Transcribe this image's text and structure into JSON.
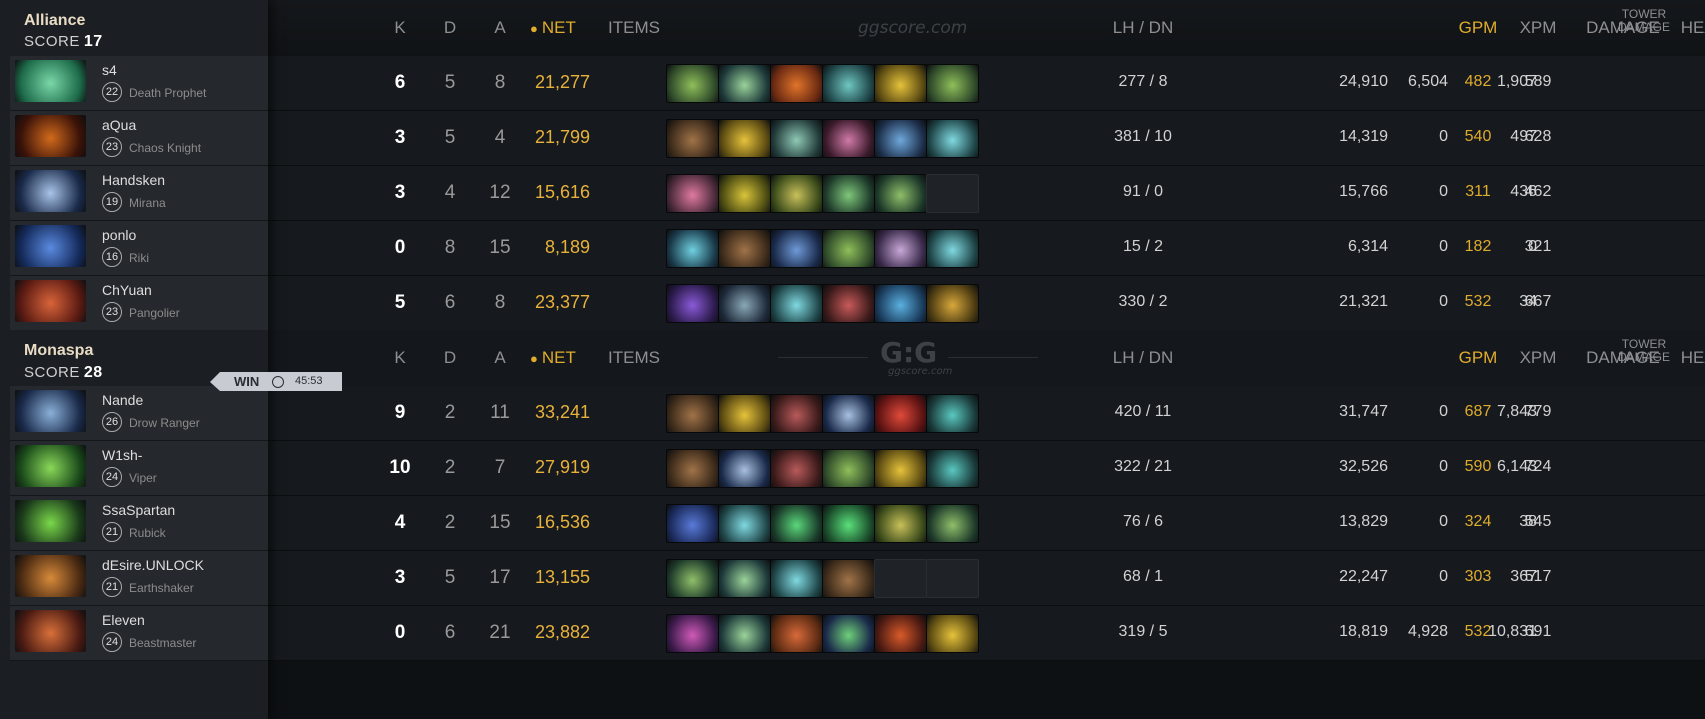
{
  "headers": {
    "k": "K",
    "d": "D",
    "a": "A",
    "net": "NET",
    "items": "ITEMS",
    "lh_dn": "LH  /  DN",
    "gpm": "GPM",
    "xpm": "XPM",
    "damage": "DAMAGE",
    "heal": "HEAL",
    "tower_line1": "TOWER",
    "tower_line2": "DAMAGE"
  },
  "watermark_top": "ggscore.com",
  "watermark_logo": "G:G",
  "watermark_sub": "ggscore.com",
  "match": {
    "result": "WIN",
    "duration": "45:53"
  },
  "teams": [
    {
      "name": "Alliance",
      "score_label": "SCORE",
      "score": "17",
      "players": [
        {
          "name": "s4",
          "level": "22",
          "hero": "Death Prophet",
          "k": "6",
          "d": "5",
          "a": "8",
          "net": "21,277",
          "lh_dn": "277  /  8",
          "gpm": "482",
          "xpm": "589",
          "damage": "24,910",
          "heal": "6,504",
          "tower": "1,907",
          "avatar": [
            "#1d6b4a",
            "#7ad7a8"
          ],
          "items": [
            [
              "#2f4a2a",
              "#8fbf5a"
            ],
            [
              "#1e3a3a",
              "#9ad39a"
            ],
            [
              "#6b2a12",
              "#e0742a"
            ],
            [
              "#1f4548",
              "#6fc7c2"
            ],
            [
              "#5a4a12",
              "#e6c23b"
            ],
            [
              "#2f4a2a",
              "#8fbf5a"
            ]
          ]
        },
        {
          "name": "aQua",
          "level": "23",
          "hero": "Chaos Knight",
          "k": "3",
          "d": "5",
          "a": "4",
          "net": "21,799",
          "lh_dn": "381  /  10",
          "gpm": "540",
          "xpm": "628",
          "damage": "14,319",
          "heal": "0",
          "tower": "497",
          "avatar": [
            "#3a1208",
            "#d26a1c"
          ],
          "items": [
            [
              "#3b2a1a",
              "#a07348"
            ],
            [
              "#5a4a12",
              "#e6c23b"
            ],
            [
              "#223b3a",
              "#8fc9b4"
            ],
            [
              "#3a1a2a",
              "#d07aa8"
            ],
            [
              "#1d2f4a",
              "#6fa8dc"
            ],
            [
              "#1f4548",
              "#7fd9e0"
            ]
          ]
        },
        {
          "name": "Handsken",
          "level": "19",
          "hero": "Mirana",
          "k": "3",
          "d": "4",
          "a": "12",
          "net": "15,616",
          "lh_dn": "91  /  0",
          "gpm": "311",
          "xpm": "462",
          "damage": "15,766",
          "heal": "0",
          "tower": "436",
          "avatar": [
            "#1a2a4a",
            "#a8c4e8"
          ],
          "items": [
            [
              "#4a2a3a",
              "#e07aa0"
            ],
            [
              "#4a4a12",
              "#d8c43b"
            ],
            [
              "#3a4a1a",
              "#c8c05a"
            ],
            [
              "#1e3a2a",
              "#7fc77a"
            ],
            [
              "#1e3a2a",
              "#8fbf6a"
            ],
            null
          ]
        },
        {
          "name": "ponlo",
          "level": "16",
          "hero": "Riki",
          "k": "0",
          "d": "8",
          "a": "15",
          "net": "8,189",
          "lh_dn": "15  /  2",
          "gpm": "182",
          "xpm": "321",
          "damage": "6,314",
          "heal": "0",
          "tower": "0",
          "avatar": [
            "#142a5a",
            "#5a8ae0"
          ],
          "items": [
            [
              "#1a3a4a",
              "#6fd0e0"
            ],
            [
              "#3b2a1a",
              "#a07348"
            ],
            [
              "#1a2a4a",
              "#6f9ad8"
            ],
            [
              "#2f4a2a",
              "#8fbf5a"
            ],
            [
              "#3a2a4a",
              "#c8a8d8"
            ],
            [
              "#1f4548",
              "#7fd9e0"
            ]
          ]
        },
        {
          "name": "ChYuan",
          "level": "23",
          "hero": "Pangolier",
          "k": "5",
          "d": "6",
          "a": "8",
          "net": "23,377",
          "lh_dn": "330  /  2",
          "gpm": "532",
          "xpm": "667",
          "damage": "21,321",
          "heal": "0",
          "tower": "34",
          "avatar": [
            "#5a1a12",
            "#d8643a"
          ],
          "items": [
            [
              "#2a1a4a",
              "#8a5ad8"
            ],
            [
              "#1e2a3a",
              "#8aa8b8"
            ],
            [
              "#1f4548",
              "#7fd9e0"
            ],
            [
              "#3a1a1a",
              "#c85a5a"
            ],
            [
              "#1a3a5a",
              "#5ab0e0"
            ],
            [
              "#4a3a12",
              "#d8a83b"
            ]
          ]
        }
      ]
    },
    {
      "name": "Monaspa",
      "score_label": "SCORE",
      "score": "28",
      "players": [
        {
          "name": "Nande",
          "level": "26",
          "hero": "Drow Ranger",
          "k": "9",
          "d": "2",
          "a": "11",
          "net": "33,241",
          "lh_dn": "420  /  11",
          "gpm": "687",
          "xpm": "779",
          "damage": "31,747",
          "heal": "0",
          "tower": "7,843",
          "avatar": [
            "#1a2a4a",
            "#8ab0d8"
          ],
          "items": [
            [
              "#3b2a1a",
              "#a07348"
            ],
            [
              "#5a4a12",
              "#e6c23b"
            ],
            [
              "#3a1a1a",
              "#b85a5a"
            ],
            [
              "#1a2a4a",
              "#a8c0e0"
            ],
            [
              "#5a1212",
              "#e04a3a"
            ],
            [
              "#1a3a3a",
              "#5ac8c0"
            ]
          ]
        },
        {
          "name": "W1sh-",
          "level": "24",
          "hero": "Viper",
          "k": "10",
          "d": "2",
          "a": "7",
          "net": "27,919",
          "lh_dn": "322  /  21",
          "gpm": "590",
          "xpm": "724",
          "damage": "32,526",
          "heal": "0",
          "tower": "6,143",
          "avatar": [
            "#1a4a1a",
            "#8ad85a"
          ],
          "items": [
            [
              "#3b2a1a",
              "#a07348"
            ],
            [
              "#1a2a4a",
              "#a8c0e0"
            ],
            [
              "#3a1a1a",
              "#b85a5a"
            ],
            [
              "#2f4a2a",
              "#8fbf5a"
            ],
            [
              "#5a4a12",
              "#e6c23b"
            ],
            [
              "#1a3a3a",
              "#5ac8c0"
            ]
          ]
        },
        {
          "name": "SsaSpartan",
          "level": "21",
          "hero": "Rubick",
          "k": "4",
          "d": "2",
          "a": "15",
          "net": "16,536",
          "lh_dn": "76  /  6",
          "gpm": "324",
          "xpm": "545",
          "damage": "13,829",
          "heal": "0",
          "tower": "38",
          "avatar": [
            "#1a3a1a",
            "#7ad84a"
          ],
          "items": [
            [
              "#1a2a5a",
              "#5a7ad8"
            ],
            [
              "#1f4548",
              "#7fd9e0"
            ],
            [
              "#1a3a2a",
              "#5ad87a"
            ],
            [
              "#1a4a2a",
              "#5ae07a"
            ],
            [
              "#3a4a1a",
              "#c8c05a"
            ],
            [
              "#1e3a2a",
              "#8fbf6a"
            ]
          ]
        },
        {
          "name": "dEsire.UNLOCK",
          "level": "21",
          "hero": "Earthshaker",
          "k": "3",
          "d": "5",
          "a": "17",
          "net": "13,155",
          "lh_dn": "68  /  1",
          "gpm": "303",
          "xpm": "517",
          "damage": "22,247",
          "heal": "0",
          "tower": "367",
          "avatar": [
            "#4a2a12",
            "#d88a3a"
          ],
          "items": [
            [
              "#1e3a2a",
              "#8fbf6a"
            ],
            [
              "#1e3a3a",
              "#9ad39a"
            ],
            [
              "#1f4548",
              "#7fd9e0"
            ],
            [
              "#3b2a1a",
              "#a07348"
            ],
            null,
            null
          ]
        },
        {
          "name": "Eleven",
          "level": "24",
          "hero": "Beastmaster",
          "k": "0",
          "d": "6",
          "a": "21",
          "net": "23,882",
          "lh_dn": "319  /  5",
          "gpm": "532",
          "xpm": "691",
          "damage": "18,819",
          "heal": "4,928",
          "tower": "10,831",
          "avatar": [
            "#4a1a12",
            "#d8703a"
          ],
          "items": [
            [
              "#3a1a4a",
              "#d05ab8"
            ],
            [
              "#1e3a3a",
              "#9ad39a"
            ],
            [
              "#5a2a12",
              "#d86a3a"
            ],
            [
              "#1a2a4a",
              "#6fd07a"
            ],
            [
              "#4a1a12",
              "#d85a2a"
            ],
            [
              "#5a4a12",
              "#e6c23b"
            ]
          ]
        }
      ]
    }
  ]
}
